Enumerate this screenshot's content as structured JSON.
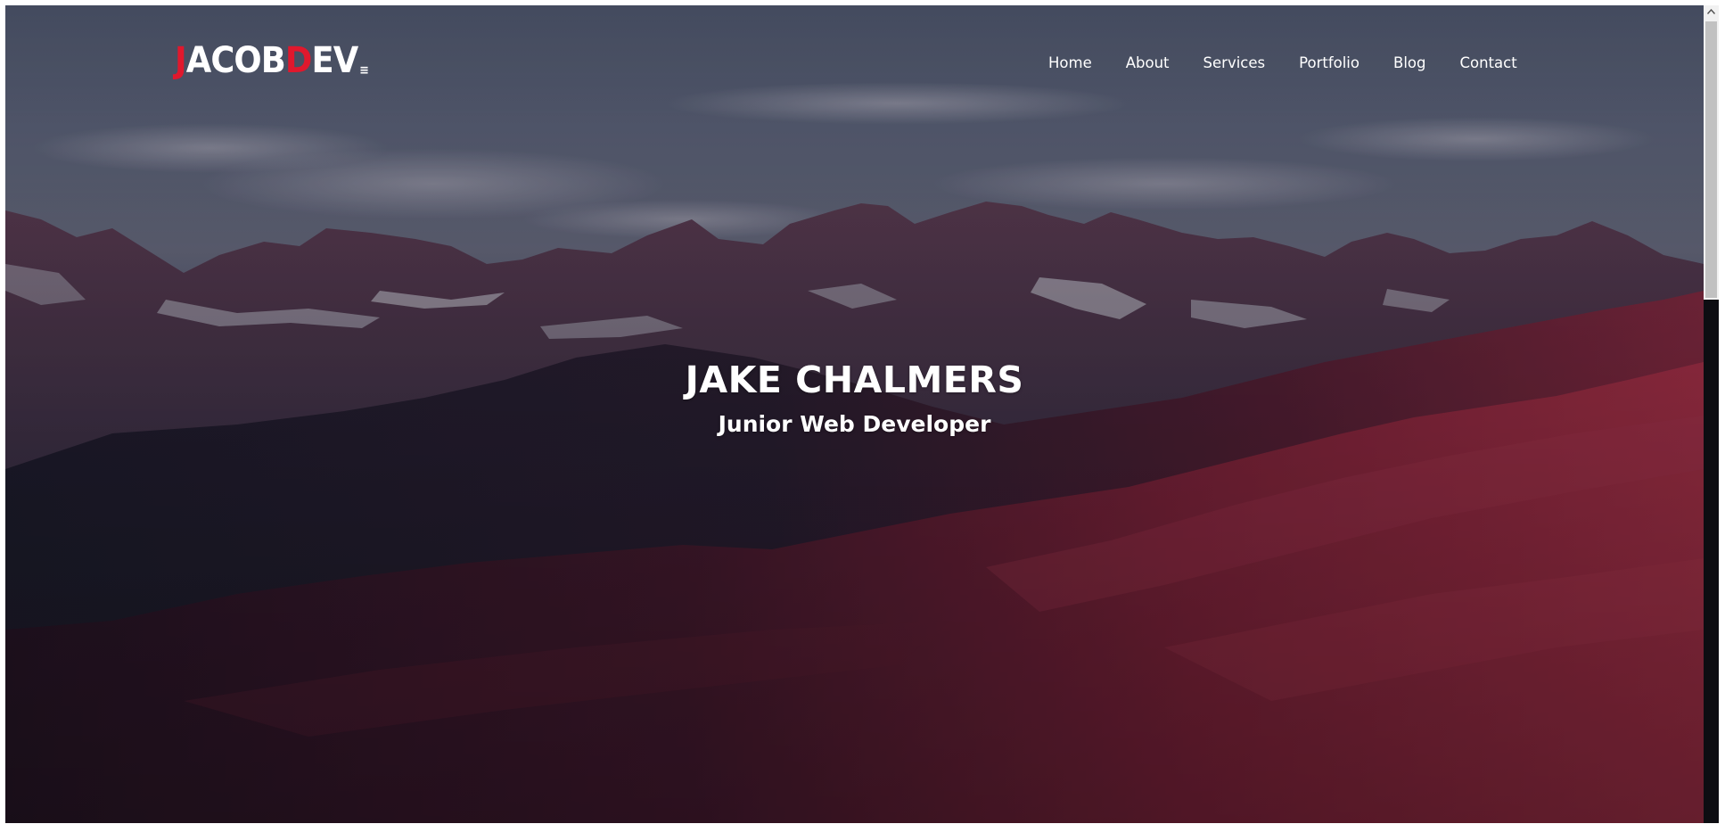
{
  "logo": {
    "part1": "J",
    "part2": "ACOB",
    "part3": "D",
    "part4": "EV",
    "menu_glyph": "≡"
  },
  "nav": {
    "items": [
      {
        "label": "Home"
      },
      {
        "label": "About"
      },
      {
        "label": "Services"
      },
      {
        "label": "Portfolio"
      },
      {
        "label": "Blog"
      },
      {
        "label": "Contact"
      }
    ]
  },
  "hero": {
    "name": "JAKE CHALMERS",
    "title": "Junior Web Developer"
  },
  "colors": {
    "accent": "#e0182d",
    "text": "#ffffff",
    "sky": "#5a6074",
    "mountain_red": "#9a2a3e"
  },
  "icons": {
    "scroll_up": "chevron-up-icon",
    "logo_menu": "hamburger-icon"
  }
}
